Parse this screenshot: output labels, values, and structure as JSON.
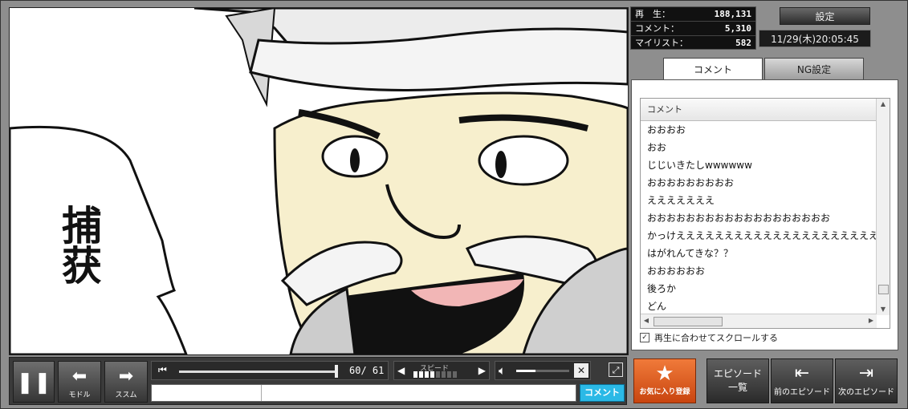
{
  "stats": {
    "views_label": "再　生：",
    "views_value": "188,131",
    "comments_label": "コメント：",
    "comments_value": "5,310",
    "mylist_label": "マイリスト：",
    "mylist_value": "582"
  },
  "settings_button": "設定",
  "datetime": "11/29(木)20:05:45",
  "tabs": {
    "comment": "コメント",
    "ng": "NG設定"
  },
  "comment_list": {
    "header": "コメント",
    "items": [
      "おおおお",
      "おお",
      "じじいきたしwwwwww",
      "おおおおおおおおお",
      "えええええええ",
      "おおおおおおおおおおおおおおおおおおお",
      "かっけえええええええええええええええええええええ",
      "はがれんてきな？？",
      "おおおおおお",
      "後ろか",
      "どん"
    ]
  },
  "autoscroll_label": "再生に合わせてスクロールする",
  "video_caption": "捕获",
  "controls": {
    "back_label": "モドル",
    "forward_label": "ススム",
    "time_display": "60/ 61",
    "speed_label": "スピード",
    "comment_submit": "コメント"
  },
  "favorite_button": "お気に入り登録",
  "episode_buttons": {
    "list_line1": "エピソード",
    "list_line2": "一覧",
    "prev": "前のエピソード",
    "next": "次のエピソード"
  }
}
